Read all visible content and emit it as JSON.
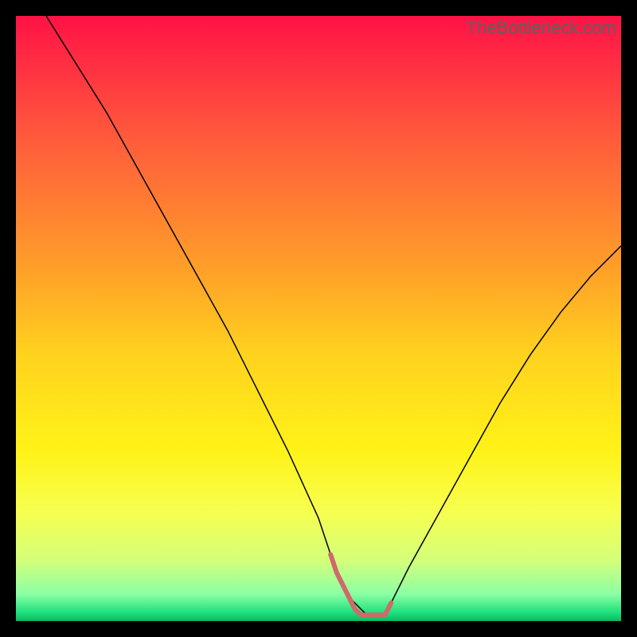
{
  "watermark": "TheBottleneck.com",
  "chart_data": {
    "type": "line",
    "title": "",
    "xlabel": "",
    "ylabel": "",
    "xlim": [
      0,
      100
    ],
    "ylim": [
      0,
      100
    ],
    "grid": false,
    "legend": false,
    "background_gradient_stops": [
      {
        "offset": 0,
        "color": "#ff1246"
      },
      {
        "offset": 0.2,
        "color": "#ff5a3c"
      },
      {
        "offset": 0.42,
        "color": "#ffa028"
      },
      {
        "offset": 0.56,
        "color": "#ffd21e"
      },
      {
        "offset": 0.72,
        "color": "#fff318"
      },
      {
        "offset": 0.82,
        "color": "#f6ff50"
      },
      {
        "offset": 0.9,
        "color": "#d4ff7a"
      },
      {
        "offset": 0.955,
        "color": "#8cffa4"
      },
      {
        "offset": 0.985,
        "color": "#22e27e"
      },
      {
        "offset": 1.0,
        "color": "#08b862"
      }
    ],
    "series": [
      {
        "name": "bottleneck-curve",
        "color": "#000000",
        "width": 1.5,
        "x": [
          0,
          5,
          10,
          15,
          20,
          25,
          30,
          35,
          40,
          45,
          50,
          52,
          55,
          58,
          61,
          62,
          65,
          70,
          75,
          80,
          85,
          90,
          95,
          100
        ],
        "y": [
          108,
          100,
          92,
          84,
          75,
          66,
          57,
          48,
          38,
          28,
          17,
          11,
          4,
          1,
          1,
          3,
          9,
          18,
          27,
          36,
          44,
          51,
          57,
          62
        ]
      },
      {
        "name": "optimal-zone-highlight",
        "color": "#cf6a6a",
        "width": 6,
        "linecap": "round",
        "x": [
          52,
          53,
          54,
          55,
          56,
          57,
          58,
          60,
          61,
          62
        ],
        "y": [
          11,
          8,
          6,
          4,
          2,
          1,
          1,
          1,
          1,
          3
        ]
      }
    ],
    "optimal_range_x_pct": [
      52,
      62
    ]
  }
}
